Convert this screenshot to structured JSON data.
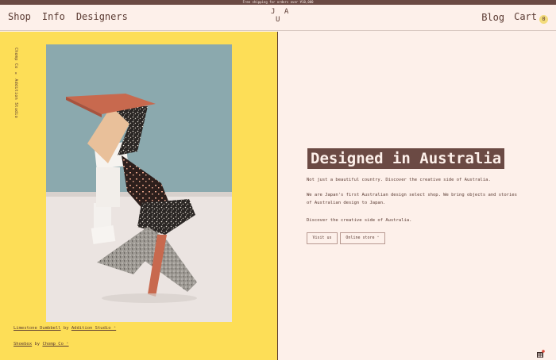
{
  "topbar": {
    "text": "Free shipping for orders over ¥10,000"
  },
  "header": {
    "nav_left": [
      "Shop",
      "Info",
      "Designers"
    ],
    "logo": {
      "line1": "J A",
      "line2": "U"
    },
    "nav_right": {
      "blog": "Blog",
      "cart": "Cart",
      "cart_count": "0"
    }
  },
  "hero_left": {
    "vertical_caption": "Chomp Co × Addition Studio",
    "credit1": {
      "item": "Limestone Dumbbell",
      "by": " by ",
      "maker": "Addition Studio ⁺"
    },
    "credit2": {
      "item": "Shoebox",
      "by": " by ",
      "maker": "Chomp Co ⁺"
    }
  },
  "hero_right": {
    "headline": "Designed in Australia",
    "para1": "Not just a beautiful country. Discover the creative side of Australia.",
    "para2": "We are Japan's first Australian design select shop. We bring objects and stories of Australian design to Japan.",
    "para3": "Discover the creative side of Australia.",
    "btn_visit": "Visit us",
    "btn_online": "Online store ⁺"
  },
  "colors": {
    "yellow": "#fdde57",
    "cream": "#fdf0ea",
    "brown": "#6b4a44"
  }
}
